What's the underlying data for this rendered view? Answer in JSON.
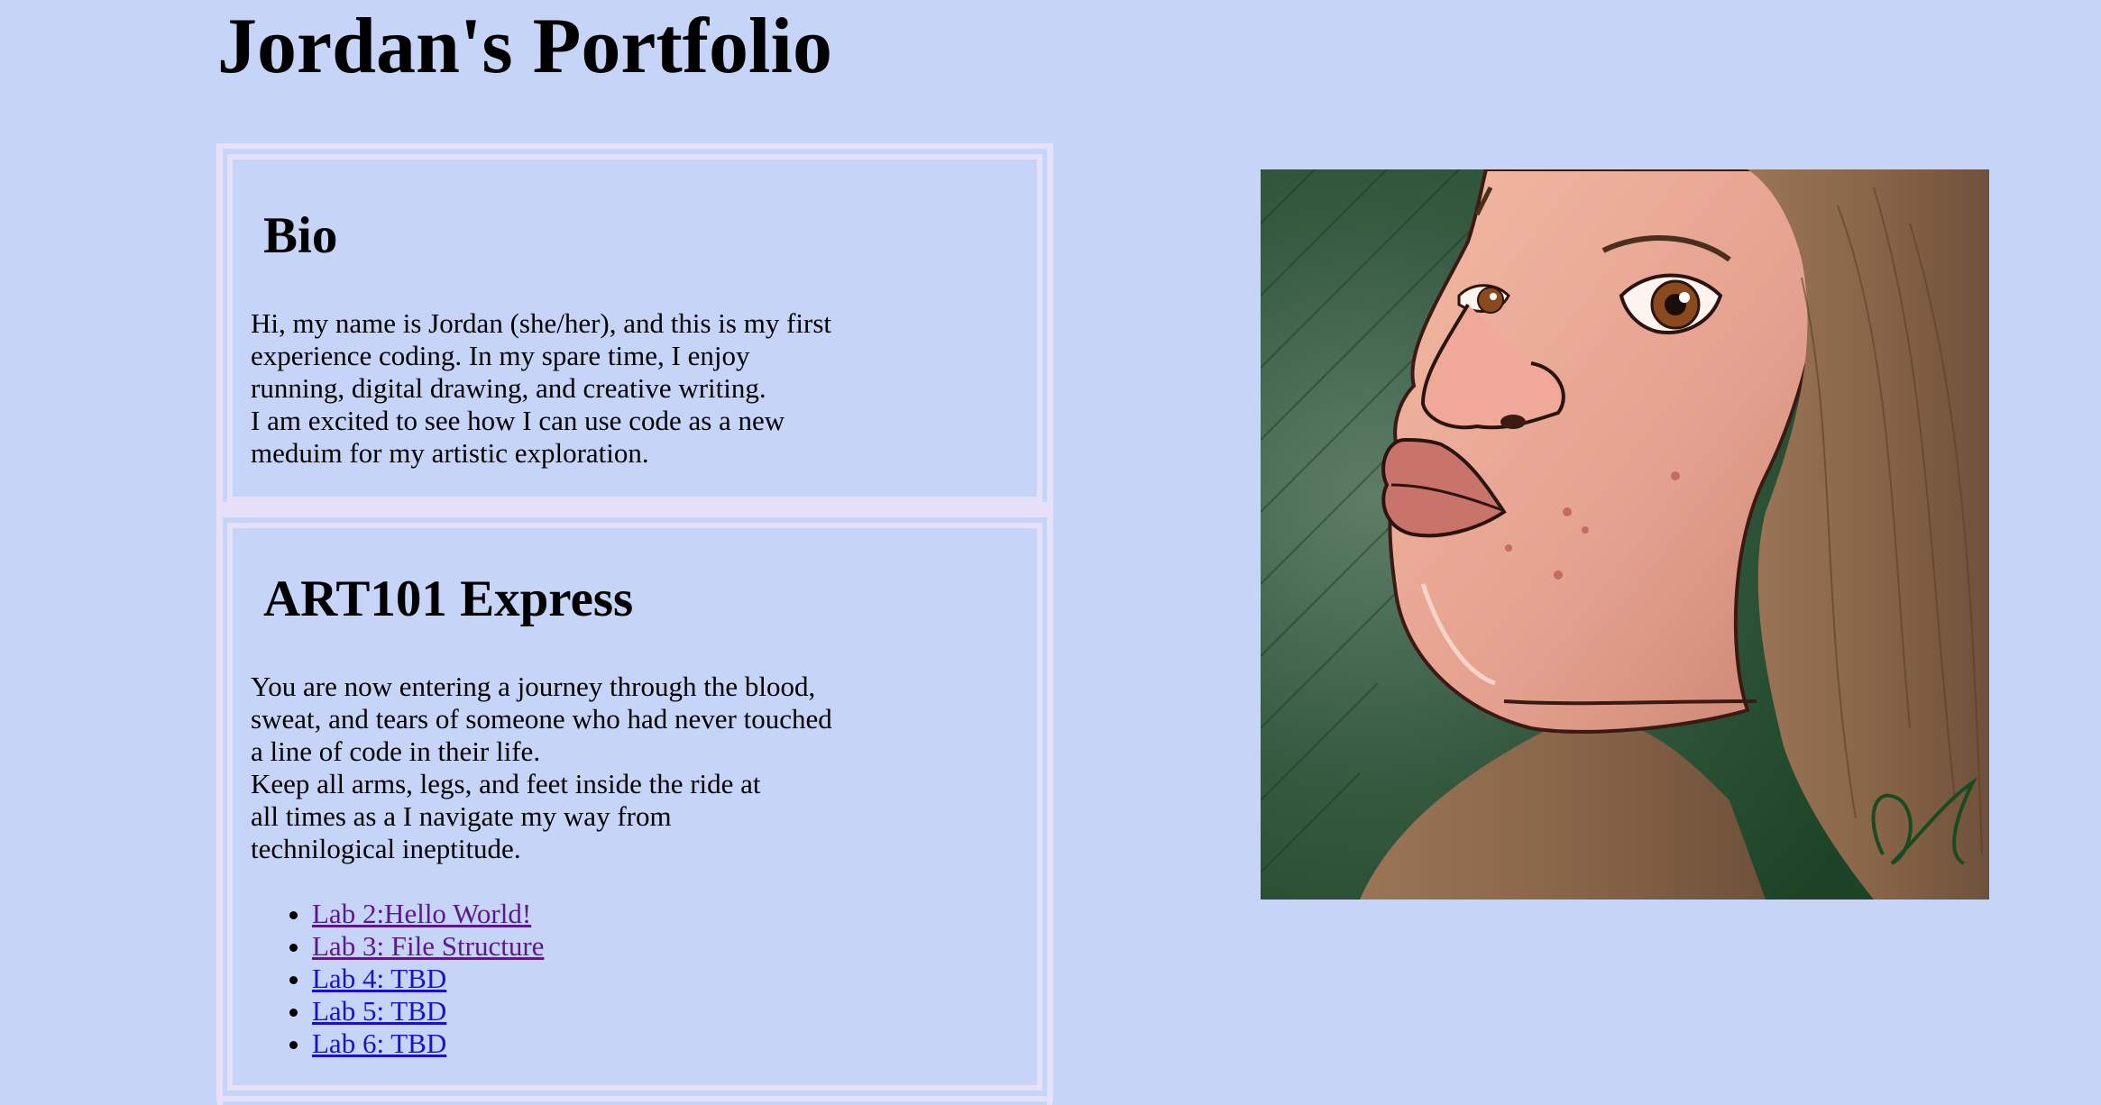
{
  "header": {
    "title": "Jordan's Portfolio"
  },
  "bio": {
    "heading": "Bio",
    "text": "Hi, my name is Jordan (she/her), and this is my first\nexperience coding. In my spare time, I enjoy\nrunning, digital drawing, and creative writing.\nI am excited to see how I can use code as a new\nmeduim for my artistic exploration."
  },
  "art": {
    "heading": "ART101 Express",
    "text": "You are now entering a journey through the blood,\nsweat, and tears of someone who had never touched\na line of code in their life.\nKeep all arms, legs, and feet inside the ride at\nall times as a I navigate my way from\ntechnilogical ineptitude.",
    "labs": [
      {
        "label": "Lab 2:Hello World!",
        "visited": true
      },
      {
        "label": "Lab 3: File Structure",
        "visited": true
      },
      {
        "label": "Lab 4: TBD",
        "visited": false
      },
      {
        "label": "Lab 5: TBD",
        "visited": false
      },
      {
        "label": "Lab 6: TBD",
        "visited": false
      }
    ]
  },
  "portrait": {
    "icon": "self-portrait-illustration"
  },
  "colors": {
    "background": "#c6d4f8",
    "box_border": "#e6e0f8",
    "link": "#1a12c9",
    "link_visited": "#5a1a8c"
  }
}
